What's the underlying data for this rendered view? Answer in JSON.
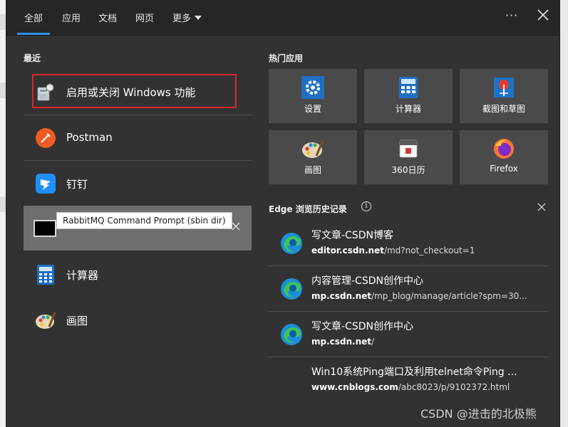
{
  "tabs": [
    {
      "label": "全部",
      "active": true
    },
    {
      "label": "应用",
      "active": false
    },
    {
      "label": "文档",
      "active": false
    },
    {
      "label": "网页",
      "active": false
    },
    {
      "label": "更多",
      "active": false
    }
  ],
  "topbar": {
    "more_icon": "ellipsis-icon",
    "close_icon": "close-icon"
  },
  "recent": {
    "title": "最近",
    "items": [
      {
        "label": "启用或关闭 Windows 功能",
        "icon": "windows-features-icon",
        "highlighted": true
      },
      {
        "label": "Postman",
        "icon": "postman-icon"
      },
      {
        "label": "钉钉",
        "icon": "dingtalk-icon"
      },
      {
        "label": "RabbitMQ Command Prompt (sbin dir)",
        "icon": "terminal-icon",
        "hovered": true,
        "tooltip": "RabbitMQ Command Prompt (sbin dir)"
      },
      {
        "label": "计算器",
        "icon": "calculator-icon"
      },
      {
        "label": "画图",
        "icon": "paint-icon"
      }
    ]
  },
  "hot_apps": {
    "title": "热门应用",
    "tiles": [
      {
        "label": "设置",
        "icon": "settings-gear-icon"
      },
      {
        "label": "计算器",
        "icon": "calculator-icon"
      },
      {
        "label": "截图和草图",
        "icon": "snip-sketch-icon"
      },
      {
        "label": "画图",
        "icon": "paint-icon"
      },
      {
        "label": "360日历",
        "icon": "calendar-icon"
      },
      {
        "label": "Firefox",
        "icon": "firefox-icon"
      }
    ]
  },
  "edge_history": {
    "title": "Edge 浏览历史记录",
    "items": [
      {
        "title": "写文章-CSDN博客",
        "domain": "editor.csdn.net",
        "path": "/md?not_checkout=1",
        "icon": "edge-icon"
      },
      {
        "title": "内容管理-CSDN创作中心",
        "domain": "mp.csdn.net",
        "path": "/mp_blog/manage/article?spm=30...",
        "icon": "edge-icon"
      },
      {
        "title": "写文章-CSDN创作中心",
        "domain": "mp.csdn.net",
        "path": "/",
        "icon": "edge-icon"
      },
      {
        "title": "Win10系统Ping端口及利用telnet命令Ping ...",
        "domain": "www.cnblogs.com",
        "path": "/abc8023/p/9102372.html",
        "icon": "none"
      }
    ]
  },
  "watermark": "CSDN @进击的北极熊",
  "colors": {
    "accent": "#2f8fe5",
    "highlight_box": "#e0242b",
    "panel": "#323232",
    "tile": "#4a4a4a"
  }
}
